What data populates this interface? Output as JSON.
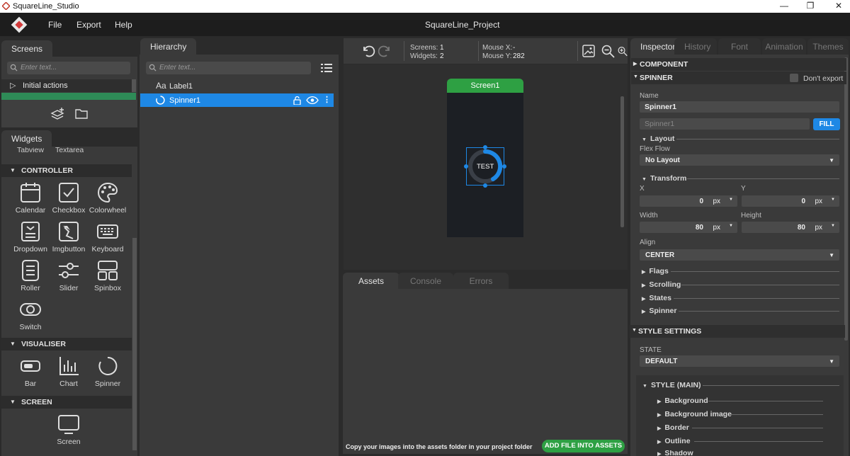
{
  "app": {
    "window_title": "SquareLine_Studio",
    "project_title": "SquareLine_Project",
    "menu": [
      "File",
      "Export",
      "Help"
    ]
  },
  "screens_panel": {
    "tab": "Screens",
    "search_placeholder": "Enter text...",
    "items": [
      "Initial actions"
    ]
  },
  "widgets_panel": {
    "tab": "Widgets",
    "partial_items": [
      "Tabview",
      "Textarea"
    ],
    "sections": [
      {
        "title": "CONTROLLER",
        "items": [
          "Calendar",
          "Checkbox",
          "Colorwheel",
          "Dropdown",
          "Imgbutton",
          "Keyboard",
          "Roller",
          "Slider",
          "Spinbox",
          "Switch"
        ]
      },
      {
        "title": "VISUALISER",
        "items": [
          "Bar",
          "Chart",
          "Spinner"
        ]
      },
      {
        "title": "SCREEN",
        "items": [
          "Screen"
        ]
      }
    ]
  },
  "hierarchy": {
    "tab": "Hierarchy",
    "search_placeholder": "Enter text...",
    "items": [
      {
        "label": "Label1",
        "icon": "Aa"
      },
      {
        "label": "Spinner1",
        "selected": true
      }
    ]
  },
  "canvas": {
    "screens_label": "Screens:",
    "screens_value": "1",
    "widgets_label": "Widgets:",
    "widgets_value": "2",
    "mouse_x_label": "Mouse X:",
    "mouse_x_value": "-",
    "mouse_y_label": "Mouse Y:",
    "mouse_y_value": "282",
    "screen_name": "Screen1",
    "spinner_text": "TEST",
    "screen_tab_color": "#2ea043",
    "accent": "#1e88e5"
  },
  "bottom_panel": {
    "tabs": [
      "Assets",
      "Console",
      "Errors"
    ],
    "hint": "Copy your images into the assets folder in your project folder",
    "add_button": "ADD FILE INTO ASSETS"
  },
  "inspector": {
    "tabs": [
      "Inspector",
      "History",
      "Font",
      "Animation",
      "Themes"
    ],
    "component_title": "COMPONENT",
    "spinner_title": "SPINNER",
    "dont_export": "Don't export",
    "name_label": "Name",
    "name_value": "Spinner1",
    "id_placeholder": "Spinner1",
    "fill_button": "FILL",
    "layout_group": "Layout",
    "flex_flow_label": "Flex Flow",
    "flex_flow_value": "No Layout",
    "transform_group": "Transform",
    "x_label": "X",
    "x_value": "0",
    "x_unit": "px",
    "y_label": "Y",
    "y_value": "0",
    "y_unit": "px",
    "width_label": "Width",
    "width_value": "80",
    "width_unit": "px",
    "height_label": "Height",
    "height_value": "80",
    "height_unit": "px",
    "align_label": "Align",
    "align_value": "CENTER",
    "groups": [
      "Flags",
      "Scrolling",
      "States",
      "Spinner"
    ],
    "style_settings_title": "STYLE SETTINGS",
    "state_label": "STATE",
    "state_value": "DEFAULT",
    "style_main_title": "STYLE (MAIN)",
    "style_items": [
      "Background",
      "Background image",
      "Border",
      "Outline",
      "Shadow"
    ]
  }
}
